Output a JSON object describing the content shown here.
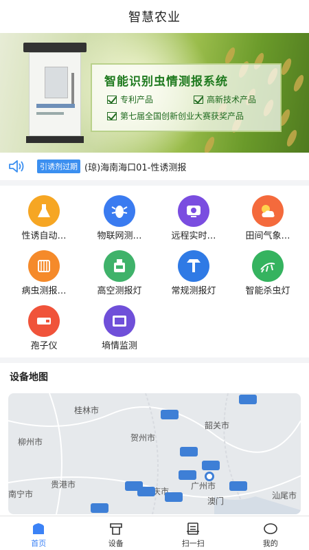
{
  "header": {
    "title": "智慧农业"
  },
  "banner": {
    "headline": "智能识别虫情测报系统",
    "features": [
      "专利产品",
      "高新技术产品",
      "第七届全国创新创业大赛获奖产品"
    ],
    "slide_count": 4,
    "active_slide": 1
  },
  "notice": {
    "tag": "引诱剂过期",
    "message": "(琼)海南海口01-性诱测报"
  },
  "services": [
    {
      "label": "性诱自动…",
      "icon": "flask-icon",
      "color": "#f6a623"
    },
    {
      "label": "物联网测…",
      "icon": "insect-icon",
      "color": "#3a7bf0"
    },
    {
      "label": "远程实时…",
      "icon": "camera-icon",
      "color": "#7a4de0"
    },
    {
      "label": "田间气象…",
      "icon": "weather-icon",
      "color": "#f46a3c"
    },
    {
      "label": "病虫测报…",
      "icon": "trap-icon",
      "color": "#f58a2a"
    },
    {
      "label": "高空测报灯",
      "icon": "lamp-box-icon",
      "color": "#3fb26a"
    },
    {
      "label": "常规测报灯",
      "icon": "lamp-icon",
      "color": "#2f7ae5"
    },
    {
      "label": "智能杀虫灯",
      "icon": "bug-killer-icon",
      "color": "#35b35f"
    },
    {
      "label": "孢子仪",
      "icon": "spore-device-icon",
      "color": "#f0533a"
    },
    {
      "label": "墒情监测",
      "icon": "monitor-icon",
      "color": "#6f4fd9"
    }
  ],
  "map_section": {
    "title": "设备地图",
    "cities": [
      "桂林市",
      "柳州市",
      "贺州市",
      "韶关市",
      "贵港市",
      "广州市",
      "肇庆市",
      "澳门",
      "汕尾市",
      "南宁市"
    ]
  },
  "tabbar": [
    {
      "label": "首页",
      "icon": "home-icon",
      "active": true
    },
    {
      "label": "设备",
      "icon": "device-icon",
      "active": false
    },
    {
      "label": "扫一扫",
      "icon": "scan-icon",
      "active": false
    },
    {
      "label": "我的",
      "icon": "profile-icon",
      "active": false
    }
  ],
  "colors": {
    "accent": "#3b82f6",
    "tag_bg": "#3b8ff0",
    "promo_green": "#1f7a1f"
  }
}
